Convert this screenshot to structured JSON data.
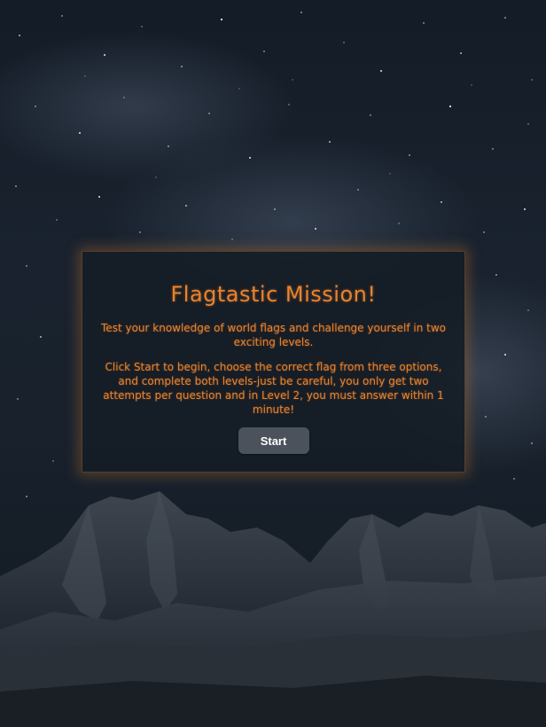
{
  "card": {
    "title": "Flagtastic Mission!",
    "intro": "Test your knowledge of world flags and challenge yourself in two exciting levels.",
    "instructions": "Click Start to begin, choose the correct flag from three options, and complete both levels-just be careful, you only get two attempts per question and in Level 2, you must answer within 1 minute!",
    "start_label": "Start"
  },
  "colors": {
    "accent": "#e8832e",
    "button": "#4b525c",
    "card_bg": "#141c26"
  }
}
